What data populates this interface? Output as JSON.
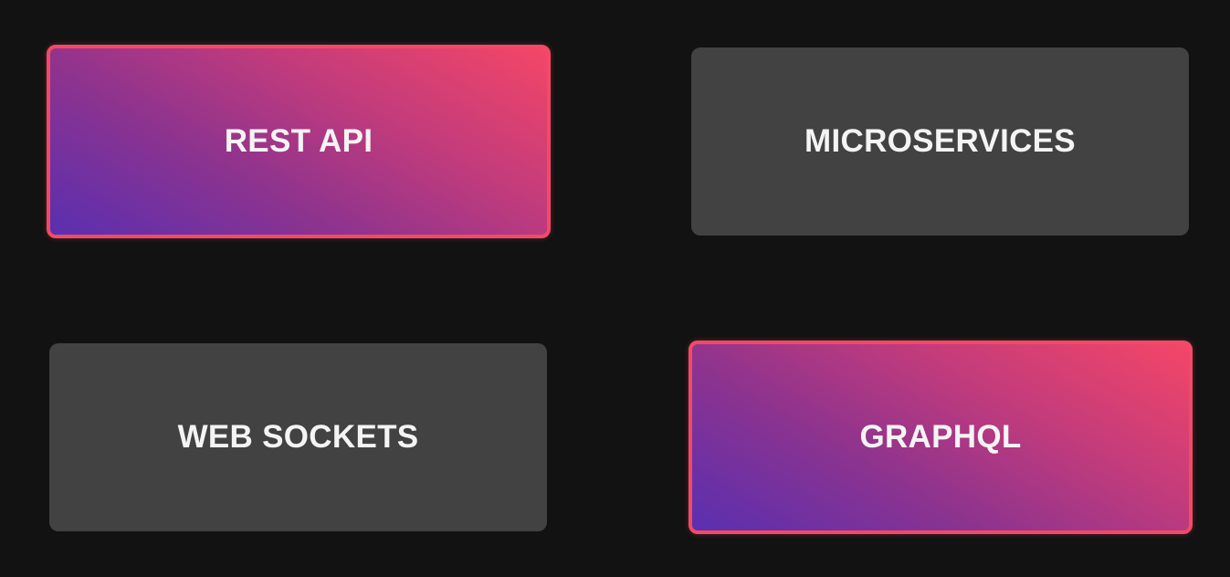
{
  "options": [
    {
      "label": "REST API",
      "state": "selected"
    },
    {
      "label": "MICROSERVICES",
      "state": "unselected"
    },
    {
      "label": "WEB SOCKETS",
      "state": "unselected"
    },
    {
      "label": "GRAPHQL",
      "state": "selected"
    }
  ],
  "colors": {
    "background": "#121212",
    "card_inactive": "#424242",
    "accent_border": "#f24a66",
    "gradient_start": "#5a2fb0",
    "gradient_end": "#f44667",
    "text": "#f4f4f4"
  }
}
